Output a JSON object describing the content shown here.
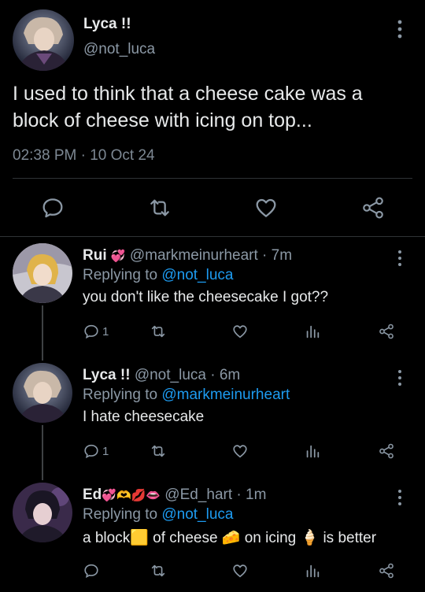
{
  "main_tweet": {
    "author_name": "Lyca !!",
    "author_handle": "@not_luca",
    "text": "I used to think that a cheese cake was a block of cheese with icing on top...",
    "timestamp": "02:38 PM · 10 Oct 24",
    "actions": [
      "reply-icon",
      "retweet-icon",
      "like-icon",
      "share-icon"
    ]
  },
  "replies": [
    {
      "name": "Rui",
      "name_emoji": "💞",
      "handle_meta": "@markmeinurheart · 7m",
      "replying_prefix": "Replying to",
      "replying_to": "@not_luca",
      "text": "you don't like the cheesecake I got??",
      "reply_count": "1"
    },
    {
      "name": "Lyca !!",
      "name_emoji": "",
      "handle_meta": "@not_luca · 6m",
      "replying_prefix": "Replying to",
      "replying_to": "@markmeinurheart",
      "text": "I hate cheesecake",
      "reply_count": "1"
    },
    {
      "name": "Ed",
      "name_emoji": "💞🫶💋👄",
      "handle_meta": "@Ed_hart · 1m",
      "replying_prefix": "Replying to",
      "replying_to": "@not_luca",
      "text": "a block🟨 of cheese 🧀 on icing 🍦 is better",
      "reply_count": ""
    }
  ],
  "colors": {
    "background": "#000000",
    "text": "#e7e9ea",
    "secondary": "#8b98a5",
    "link": "#1d9bf0",
    "divider": "#2f3336"
  }
}
